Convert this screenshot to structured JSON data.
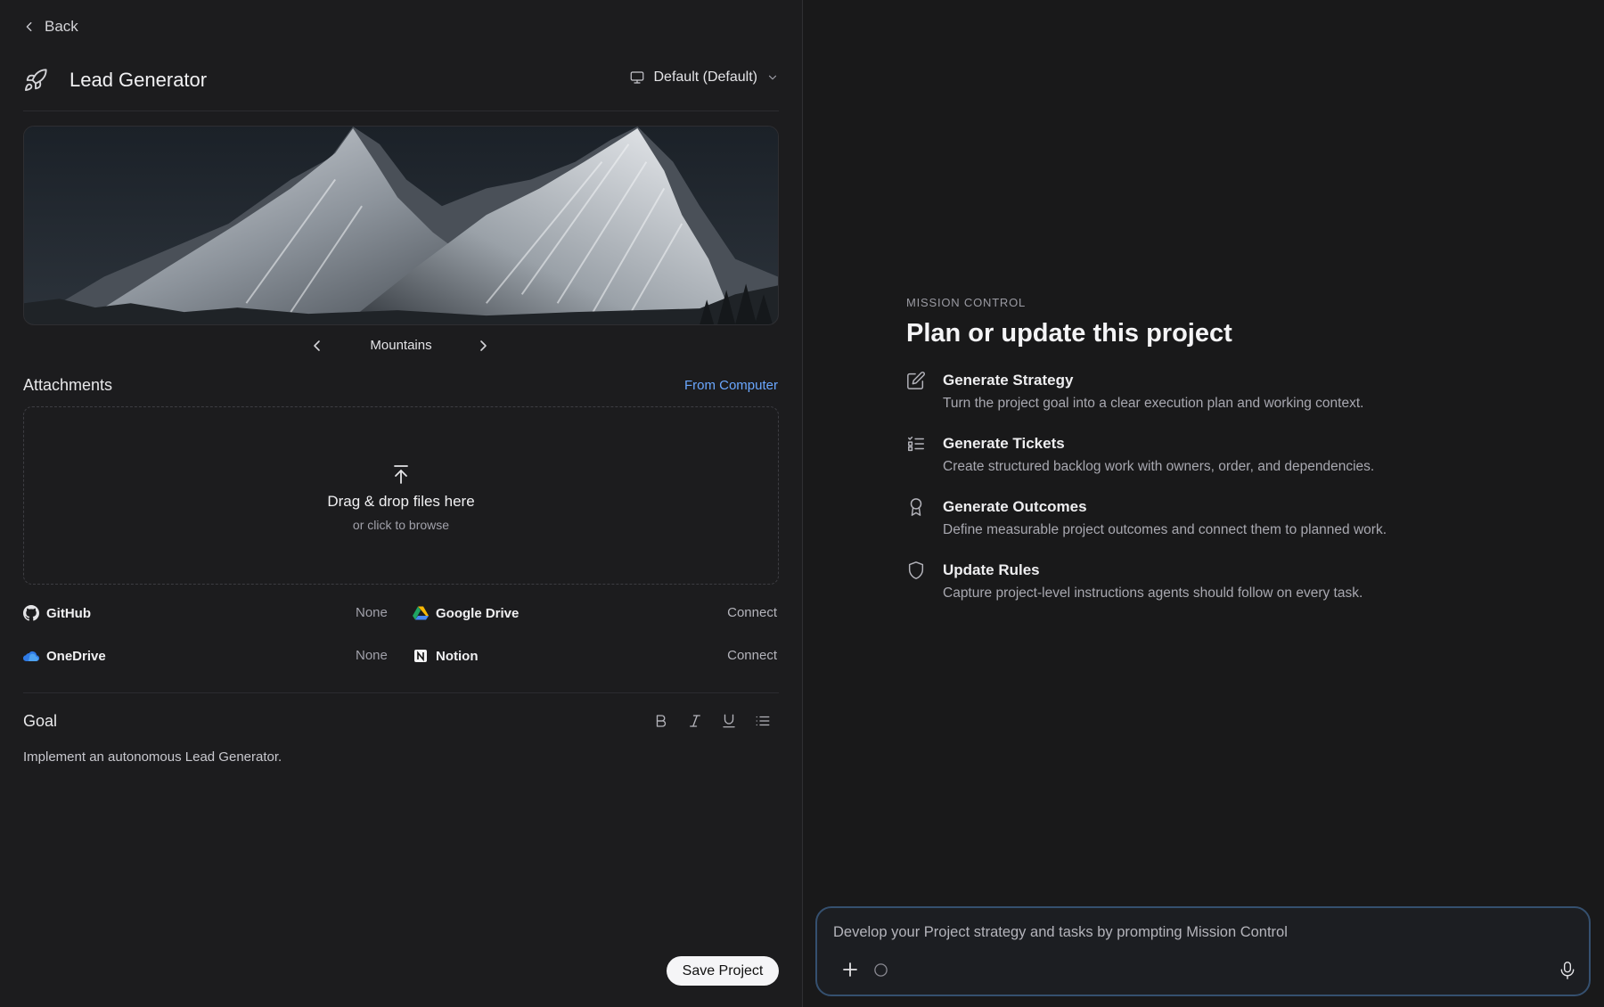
{
  "nav": {
    "back_label": "Back"
  },
  "project": {
    "title": "Lead Generator",
    "environment": "Default (Default)"
  },
  "cover": {
    "name": "Mountains"
  },
  "attachments": {
    "title": "Attachments",
    "from_computer": "From Computer",
    "drop_title": "Drag & drop files here",
    "drop_sub": "or click to browse"
  },
  "integrations": [
    {
      "name": "GitHub",
      "status": "None",
      "icon": "github-icon"
    },
    {
      "name": "Google Drive",
      "status": "Connect",
      "icon": "google-drive-icon"
    },
    {
      "name": "OneDrive",
      "status": "None",
      "icon": "onedrive-icon"
    },
    {
      "name": "Notion",
      "status": "Connect",
      "icon": "notion-icon"
    }
  ],
  "goal": {
    "title": "Goal",
    "text": "Implement an autonomous Lead Generator."
  },
  "save_label": "Save Project",
  "mission": {
    "label": "MISSION CONTROL",
    "title": "Plan or update this project",
    "actions": [
      {
        "title": "Generate Strategy",
        "desc": "Turn the project goal into a clear execution plan and working context.",
        "icon": "edit-icon"
      },
      {
        "title": "Generate Tickets",
        "desc": "Create structured backlog work with owners, order, and dependencies.",
        "icon": "list-check-icon"
      },
      {
        "title": "Generate Outcomes",
        "desc": "Define measurable project outcomes and connect them to planned work.",
        "icon": "award-icon"
      },
      {
        "title": "Update Rules",
        "desc": "Capture project-level instructions agents should follow on every task.",
        "icon": "shield-icon"
      }
    ]
  },
  "prompt": {
    "placeholder": "Develop your Project strategy and tasks by prompting Mission Control"
  },
  "colors": {
    "accent_link": "#6aa7ff",
    "prompt_border": "#35506f"
  }
}
